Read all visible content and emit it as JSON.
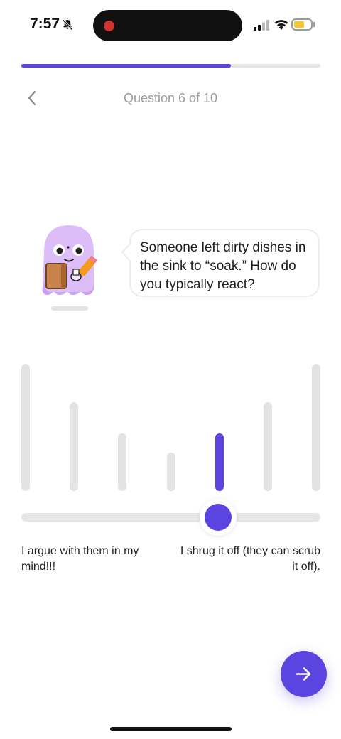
{
  "status_bar": {
    "time": "7:57",
    "battery_color": "#f4c630",
    "recording_color": "#d0342c"
  },
  "progress": {
    "value": 0.7
  },
  "header": {
    "back_icon": "chevron-left-icon",
    "question_counter": "Question 6 of 10"
  },
  "prompt": {
    "text": "Someone left dirty dishes in the sink to “soak.” How do you typically react?"
  },
  "scale": {
    "options_count": 7,
    "selected_index": 4,
    "bar_levels": [
      1.0,
      0.7,
      0.45,
      0.3,
      0.45,
      0.7,
      1.0
    ],
    "left_label": "I argue with them in my mind!!!",
    "right_label": "I shrug it off (they can scrub it off)."
  },
  "theme": {
    "accent": "#5b44e0",
    "inactive_bar": "#e3e3e3",
    "mascot": "#dcbdf7"
  },
  "next_button": {
    "icon": "arrow-right-icon"
  }
}
